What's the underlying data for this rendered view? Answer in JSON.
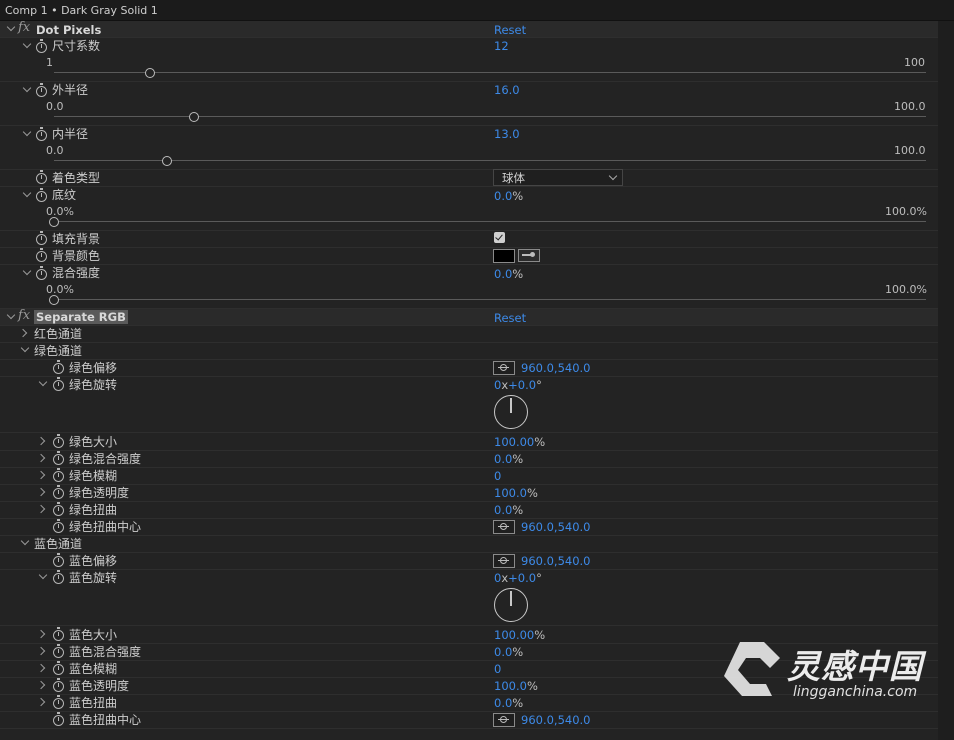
{
  "title": "Comp 1 • Dark Gray Solid 1",
  "effects": [
    {
      "name": "Dot Pixels",
      "reset": "Reset",
      "props": [
        {
          "label": "尺寸系数",
          "value": "12",
          "min": "1",
          "max": "100",
          "level": 0.11
        },
        {
          "label": "外半径",
          "value": "16.0",
          "min": "0.0",
          "max": "100.0",
          "level": 0.16
        },
        {
          "label": "内半径",
          "value": "13.0",
          "min": "0.0",
          "max": "100.0",
          "level": 0.13
        },
        {
          "label": "着色类型",
          "value": "球体"
        },
        {
          "label": "底纹",
          "value": "0.0",
          "unit": "%",
          "min": "0.0%",
          "max": "100.0%",
          "level": 0.0
        },
        {
          "label": "填充背景",
          "checked": true
        },
        {
          "label": "背景颜色",
          "color": "#000000"
        },
        {
          "label": "混合强度",
          "value": "0.0",
          "unit": "%",
          "min": "0.0%",
          "max": "100.0%",
          "level": 0.0
        }
      ]
    },
    {
      "name": "Separate RGB",
      "reset": "Reset",
      "groups": [
        {
          "label": "红色通道"
        },
        {
          "label": "绿色通道",
          "props": [
            {
              "label": "绿色偏移",
              "value": "960.0,540.0"
            },
            {
              "label": "绿色旋转",
              "turns": "0",
              "x": "x",
              "deg": "+0.0",
              "deg_unit": "°"
            },
            {
              "label": "绿色大小",
              "value": "100.00",
              "unit": "%"
            },
            {
              "label": "绿色混合强度",
              "value": "0.0",
              "unit": "%"
            },
            {
              "label": "绿色模糊",
              "value": "0"
            },
            {
              "label": "绿色透明度",
              "value": "100.0",
              "unit": "%"
            },
            {
              "label": "绿色扭曲",
              "value": "0.0",
              "unit": "%"
            },
            {
              "label": "绿色扭曲中心",
              "value": "960.0,540.0"
            }
          ]
        },
        {
          "label": "蓝色通道",
          "props": [
            {
              "label": "蓝色偏移",
              "value": "960.0,540.0"
            },
            {
              "label": "蓝色旋转",
              "turns": "0",
              "x": "x",
              "deg": "+0.0",
              "deg_unit": "°"
            },
            {
              "label": "蓝色大小",
              "value": "100.00",
              "unit": "%"
            },
            {
              "label": "蓝色混合强度",
              "value": "0.0",
              "unit": "%"
            },
            {
              "label": "蓝色模糊",
              "value": "0"
            },
            {
              "label": "蓝色透明度",
              "value": "100.0",
              "unit": "%"
            },
            {
              "label": "蓝色扭曲",
              "value": "0.0",
              "unit": "%"
            },
            {
              "label": "蓝色扭曲中心",
              "value": "960.0,540.0"
            }
          ]
        }
      ]
    }
  ],
  "watermark": {
    "cn": "灵感中国",
    "en": "lingganchina.com"
  }
}
